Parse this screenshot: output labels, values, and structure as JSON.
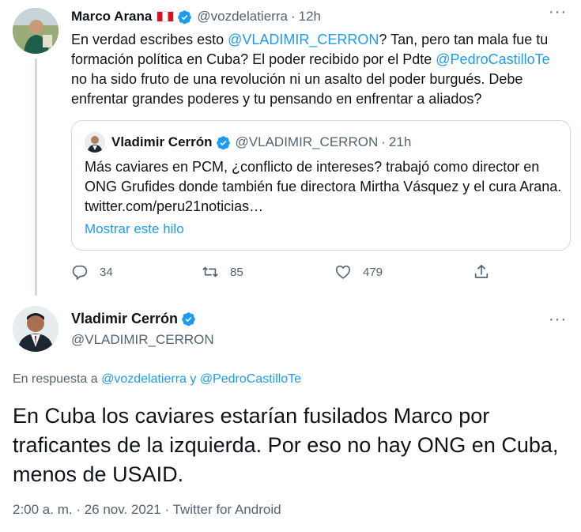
{
  "parent_tweet": {
    "author_name": "Marco Arana",
    "handle": "@vozdelatierra",
    "separator": "·",
    "time": "12h",
    "more_icon": "···",
    "text_parts": {
      "p1": "En verdad escribes esto ",
      "mention1": "@VLADIMIR_CERRON",
      "p2": "? Tan, pero tan mala fue tu formación política en Cuba? El poder recibido por el Pdte ",
      "mention2": "@PedroCastilloTe",
      "p3": " no ha sido fruto de una revolución ni un asalto del poder burgués. Debe enfrentar grandes poderes y tu pensando en enfrentar a aliados?"
    },
    "quote": {
      "author_name": "Vladimir Cerrón",
      "handle": "@VLADIMIR_CERRON",
      "separator": "·",
      "time": "21h",
      "text": "Más caviares en PCM, ¿conflicto de intereses? trabajó como director en ONG Grufides donde también fue directora Mirtha Vásquez y el cura Arana. twitter.com/peru21noticias…",
      "show_thread": "Mostrar este hilo"
    },
    "actions": {
      "replies": "34",
      "retweets": "85",
      "likes": "479"
    }
  },
  "main_tweet": {
    "author_name": "Vladimir Cerrón",
    "handle": "@VLADIMIR_CERRON",
    "more_icon": "···",
    "reply_prefix": "En respuesta a ",
    "reply_user1": "@vozdelatierra",
    "reply_and": " y ",
    "reply_user2": "@PedroCastilloTe",
    "text": "En Cuba los caviares estarían fusilados Marco por traficantes de la izquierda. Por eso no hay ONG en Cuba, menos de USAID.",
    "meta": "2:00 a. m. · 26 nov. 2021 · Twitter for Android"
  },
  "colors": {
    "link": "#1d9bf0",
    "muted": "#536471",
    "border": "#cfd9de",
    "verified": "#1d9bf0"
  },
  "icons": {
    "verified": "verified-badge-icon",
    "reply": "reply-icon",
    "retweet": "retweet-icon",
    "like": "heart-icon",
    "share": "share-icon",
    "more": "more-icon"
  }
}
